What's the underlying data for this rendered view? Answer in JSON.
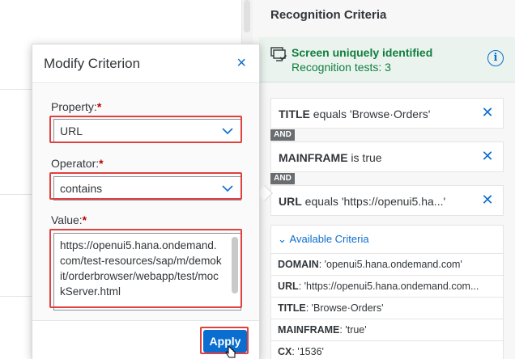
{
  "right_panel": {
    "title": "Recognition Criteria",
    "status": {
      "title": "Screen uniquely identified",
      "subtitle": "Recognition tests: 3",
      "icon": "screen-check-icon",
      "info_icon": "i"
    },
    "and_label": "AND",
    "criteria": [
      {
        "name": "TITLE",
        "text": " equals 'Browse·Orders'"
      },
      {
        "name": "MAINFRAME",
        "text": " is true"
      },
      {
        "name": "URL",
        "text": " equals 'https://openui5.ha...'"
      }
    ],
    "available": {
      "header": "Available Criteria",
      "rows": [
        {
          "name": "DOMAIN",
          "value": ": 'openui5.hana.ondemand.com'"
        },
        {
          "name": "URL",
          "value": ": 'https://openui5.hana.ondemand.com..."
        },
        {
          "name": "TITLE",
          "value": ": 'Browse·Orders'"
        },
        {
          "name": "MAINFRAME",
          "value": ": 'true'"
        },
        {
          "name": "CX",
          "value": ": '1536'"
        }
      ]
    }
  },
  "dialog": {
    "title": "Modify Criterion",
    "close_icon": "×",
    "property_label": "Property:",
    "property_value": "URL",
    "operator_label": "Operator:",
    "operator_value": "contains",
    "value_label": "Value:",
    "value_text": "https://openui5.hana.ondemand.com/test-resources/sap/m/demokit/orderbrowser/webapp/test/mockServer.html",
    "required_mark": "*",
    "apply_label": "Apply"
  },
  "colors": {
    "accent": "#0a6ed1",
    "success": "#107e3e",
    "highlight": "#e0403f"
  }
}
